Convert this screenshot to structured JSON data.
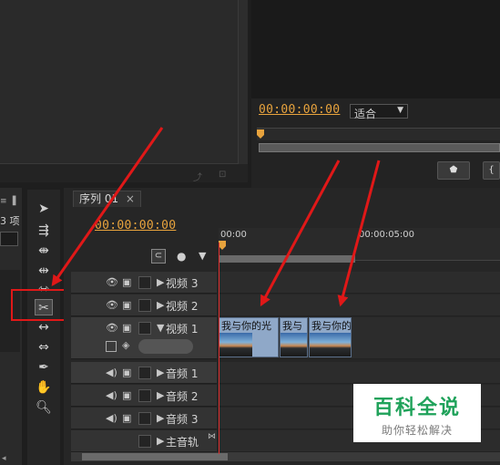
{
  "program_monitor": {
    "timecode": "00:00:00:00",
    "zoom_value": "适合",
    "zoom_arrow": "▼"
  },
  "timeline": {
    "tab_label": "序列 01",
    "tab_close": "×",
    "timecode": "00:00:00:00",
    "ruler_start": "00:00",
    "ruler_mark": "00:00:05:00",
    "tracks": [
      {
        "name": "视频 3"
      },
      {
        "name": "视频 2"
      },
      {
        "name": "视频 1"
      },
      {
        "name": "音频 1"
      },
      {
        "name": "音频 2"
      },
      {
        "name": "音频 3"
      },
      {
        "name": "主音轨"
      }
    ],
    "clips": [
      {
        "label": "我与你的光"
      },
      {
        "label": "我与"
      },
      {
        "label": "我与你的"
      }
    ]
  },
  "project_panel": {
    "item_count": "3 项"
  },
  "watermark": {
    "title": "百科全说",
    "subtitle": "助你轻松解决"
  },
  "colors": {
    "accent_timecode": "#e8a33d",
    "highlight_red": "#e01818",
    "clip_blue": "#8fa8c8",
    "watermark_green": "#1fa25a"
  },
  "icons": {
    "selection_tool": "arrow-pointer-icon",
    "razor_tool": "razor-icon",
    "hand_tool": "hand-icon",
    "zoom_tool": "magnifier-icon"
  }
}
